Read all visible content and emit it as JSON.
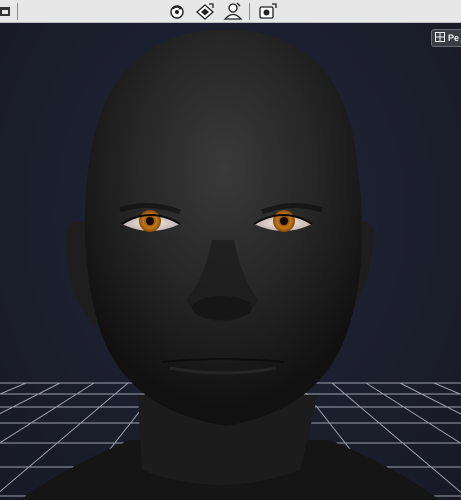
{
  "toolbar": {
    "left_icon": "window-icon",
    "icons": [
      "rotate-view-icon",
      "pan-view-icon",
      "figure-view-icon",
      "render-camera-icon"
    ]
  },
  "viewport": {
    "camera_label": "Pe",
    "camera_icon": "camera-grid-icon",
    "background_color": "#1b1e2b",
    "grid_color": "#c9ccd6",
    "eye_color": "#c47a14"
  }
}
